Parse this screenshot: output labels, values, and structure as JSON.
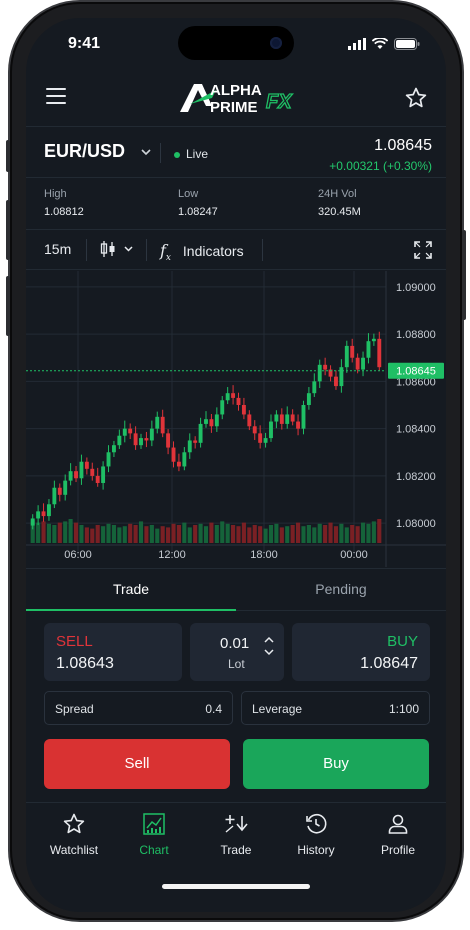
{
  "status_bar": {
    "time": "9:41"
  },
  "app": {
    "logo_line1": "ALPHA",
    "logo_line2": "PRIME",
    "logo_mark": "FX"
  },
  "instrument": {
    "pair": "EUR/USD",
    "live_label": "Live",
    "price": "1.08645",
    "change": "+0.00321 (+0.30%)"
  },
  "stats": [
    {
      "label": "High",
      "value": "1.08812"
    },
    {
      "label": "Low",
      "value": "1.08247"
    },
    {
      "label": "24H Vol",
      "value": "320.45M"
    }
  ],
  "toolbar": {
    "interval": "15m",
    "indicators_label": "Indicators"
  },
  "chart_data": {
    "type": "candlestick",
    "y_ticks": [
      "1.09000",
      "1.08800",
      "1.08600",
      "1.08400",
      "1.08200",
      "1.08000"
    ],
    "x_ticks": [
      "06:00",
      "12:00",
      "18:00",
      "00:00"
    ],
    "ylim": [
      1.0795,
      1.0905
    ],
    "current_price_label": "1.08645",
    "current_price": 1.08645,
    "candles_close": [
      1.0802,
      1.0805,
      1.0803,
      1.0808,
      1.0815,
      1.0812,
      1.0818,
      1.0822,
      1.0819,
      1.0826,
      1.0823,
      1.082,
      1.0817,
      1.0824,
      1.083,
      1.0833,
      1.0837,
      1.084,
      1.0838,
      1.0833,
      1.0836,
      1.0835,
      1.084,
      1.0845,
      1.0838,
      1.0832,
      1.0826,
      1.0824,
      1.083,
      1.0835,
      1.0834,
      1.0842,
      1.0844,
      1.0841,
      1.0846,
      1.0852,
      1.0855,
      1.0853,
      1.085,
      1.0846,
      1.0841,
      1.0838,
      1.0834,
      1.0836,
      1.0843,
      1.0846,
      1.0842,
      1.0846,
      1.0843,
      1.084,
      1.085,
      1.0855,
      1.086,
      1.0867,
      1.0865,
      1.0862,
      1.0858,
      1.0866,
      1.0875,
      1.087,
      1.0865,
      1.087,
      1.0877,
      1.0878,
      1.0866
    ],
    "volume": [
      38,
      34,
      36,
      32,
      30,
      34,
      36,
      40,
      34,
      30,
      26,
      24,
      30,
      28,
      32,
      30,
      26,
      28,
      32,
      30,
      36,
      28,
      30,
      24,
      28,
      26,
      32,
      30,
      34,
      26,
      30,
      32,
      28,
      34,
      30,
      36,
      32,
      30,
      28,
      34,
      26,
      30,
      28,
      24,
      30,
      32,
      26,
      28,
      30,
      34,
      28,
      30,
      26,
      32,
      30,
      34,
      28,
      32,
      26,
      30,
      28,
      34,
      32,
      36,
      40
    ]
  },
  "trade_tabs": [
    {
      "label": "Trade",
      "active": true
    },
    {
      "label": "Pending",
      "active": false
    }
  ],
  "order": {
    "sell_label": "SELL",
    "sell_price": "1.08643",
    "lot_value": "0.01",
    "lot_label": "Lot",
    "buy_label": "BUY",
    "buy_price": "1.08647"
  },
  "params": {
    "spread_label": "Spread",
    "spread_value": "0.4",
    "leverage_label": "Leverage",
    "leverage_value": "1:100"
  },
  "actions": {
    "sell": "Sell",
    "buy": "Buy"
  },
  "nav": [
    {
      "label": "Watchlist",
      "icon": "star-icon"
    },
    {
      "label": "Chart",
      "icon": "chart-icon",
      "active": true
    },
    {
      "label": "Trade",
      "icon": "trade-icon"
    },
    {
      "label": "History",
      "icon": "history-icon"
    },
    {
      "label": "Profile",
      "icon": "profile-icon"
    }
  ],
  "colors": {
    "up": "#1fbf65",
    "down": "#e0343a",
    "background": "#151a21",
    "accent": "#1fbf65"
  }
}
